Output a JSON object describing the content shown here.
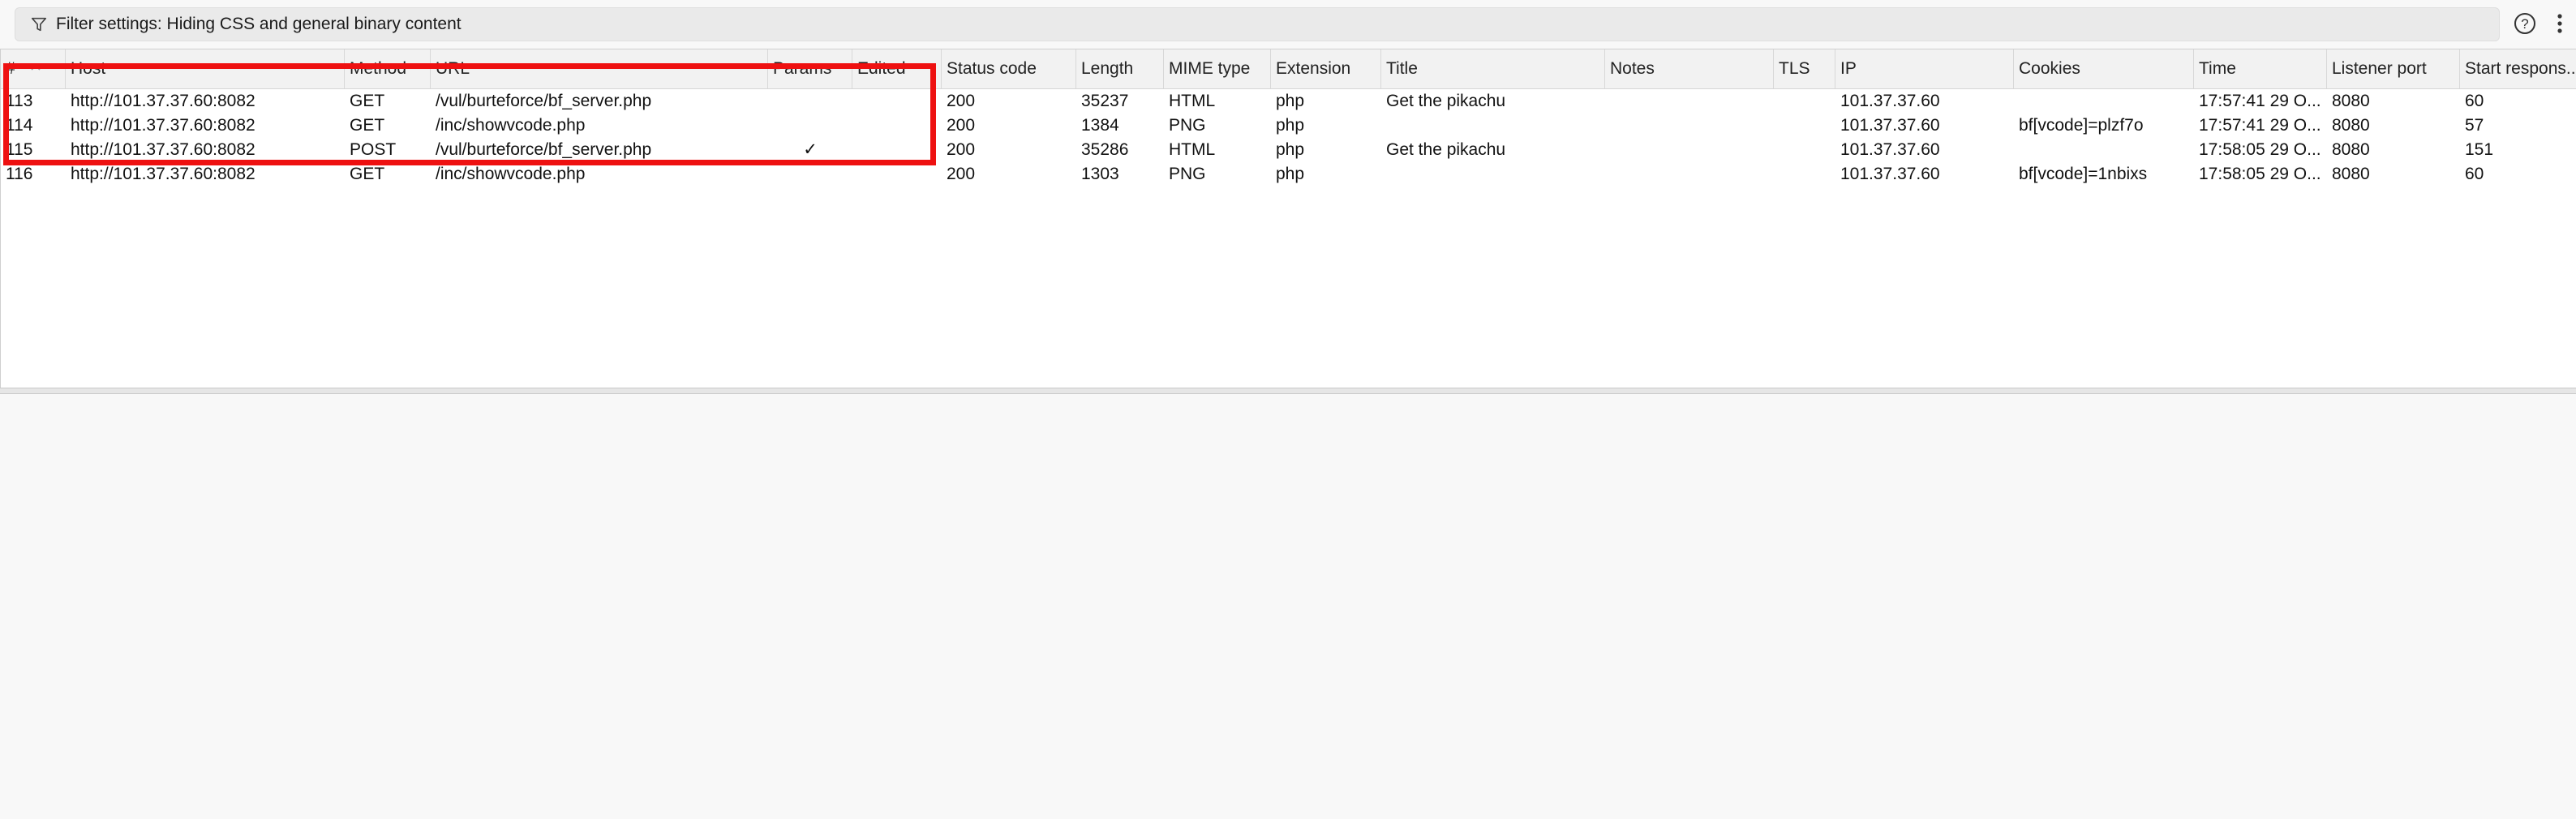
{
  "filter": {
    "label": "Filter settings: Hiding CSS and general binary content",
    "icon": "filter-icon"
  },
  "toolbar": {
    "help_icon": "help-circle-icon",
    "more_icon": "more-vertical-icon"
  },
  "table": {
    "sort": {
      "column": "#",
      "direction": "ascending"
    },
    "columns": [
      "#",
      "Host",
      "Method",
      "URL",
      "Params",
      "Edited",
      "Status code",
      "Length",
      "MIME type",
      "Extension",
      "Title",
      "Notes",
      "TLS",
      "IP",
      "Cookies",
      "Time",
      "Listener port",
      "Start respons..."
    ],
    "rows": [
      [
        "113",
        "http://101.37.37.60:8082",
        "GET",
        "/vul/burteforce/bf_server.php",
        "",
        "",
        "200",
        "35237",
        "HTML",
        "php",
        "Get the pikachu",
        "",
        "",
        "101.37.37.60",
        "",
        "17:57:41 29 O...",
        "8080",
        "60"
      ],
      [
        "114",
        "http://101.37.37.60:8082",
        "GET",
        "/inc/showvcode.php",
        "",
        "",
        "200",
        "1384",
        "PNG",
        "php",
        "",
        "",
        "",
        "101.37.37.60",
        "bf[vcode]=plzf7o",
        "17:57:41 29 O...",
        "8080",
        "57"
      ],
      [
        "115",
        "http://101.37.37.60:8082",
        "POST",
        "/vul/burteforce/bf_server.php",
        "✓",
        "",
        "200",
        "35286",
        "HTML",
        "php",
        "Get the pikachu",
        "",
        "",
        "101.37.37.60",
        "",
        "17:58:05 29 O...",
        "8080",
        "151"
      ],
      [
        "116",
        "http://101.37.37.60:8082",
        "GET",
        "/inc/showvcode.php",
        "",
        "",
        "200",
        "1303",
        "PNG",
        "php",
        "",
        "",
        "",
        "101.37.37.60",
        "bf[vcode]=1nbixs",
        "17:58:05 29 O...",
        "8080",
        "60"
      ]
    ]
  },
  "annotation": {
    "color": "#ee1111",
    "rows_highlighted": [
      "113",
      "114",
      "115"
    ]
  }
}
